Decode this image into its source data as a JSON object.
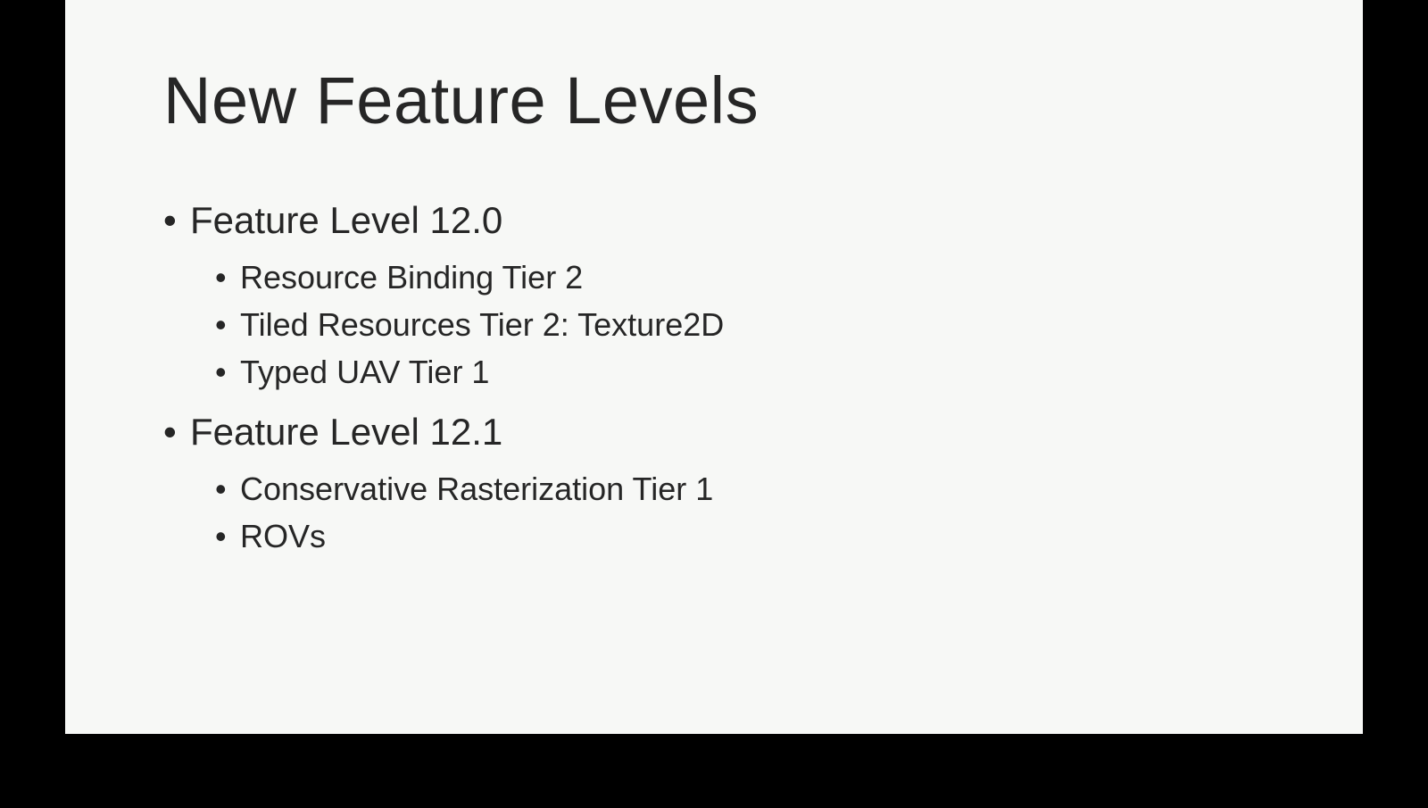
{
  "slide": {
    "title": "New Feature Levels",
    "bullets": [
      {
        "text": "Feature Level 12.0",
        "sub": [
          "Resource Binding Tier 2",
          "Tiled Resources Tier 2: Texture2D",
          "Typed UAV Tier 1"
        ]
      },
      {
        "text": "Feature Level 12.1",
        "sub": [
          "Conservative Rasterization Tier 1",
          "ROVs"
        ]
      }
    ]
  }
}
